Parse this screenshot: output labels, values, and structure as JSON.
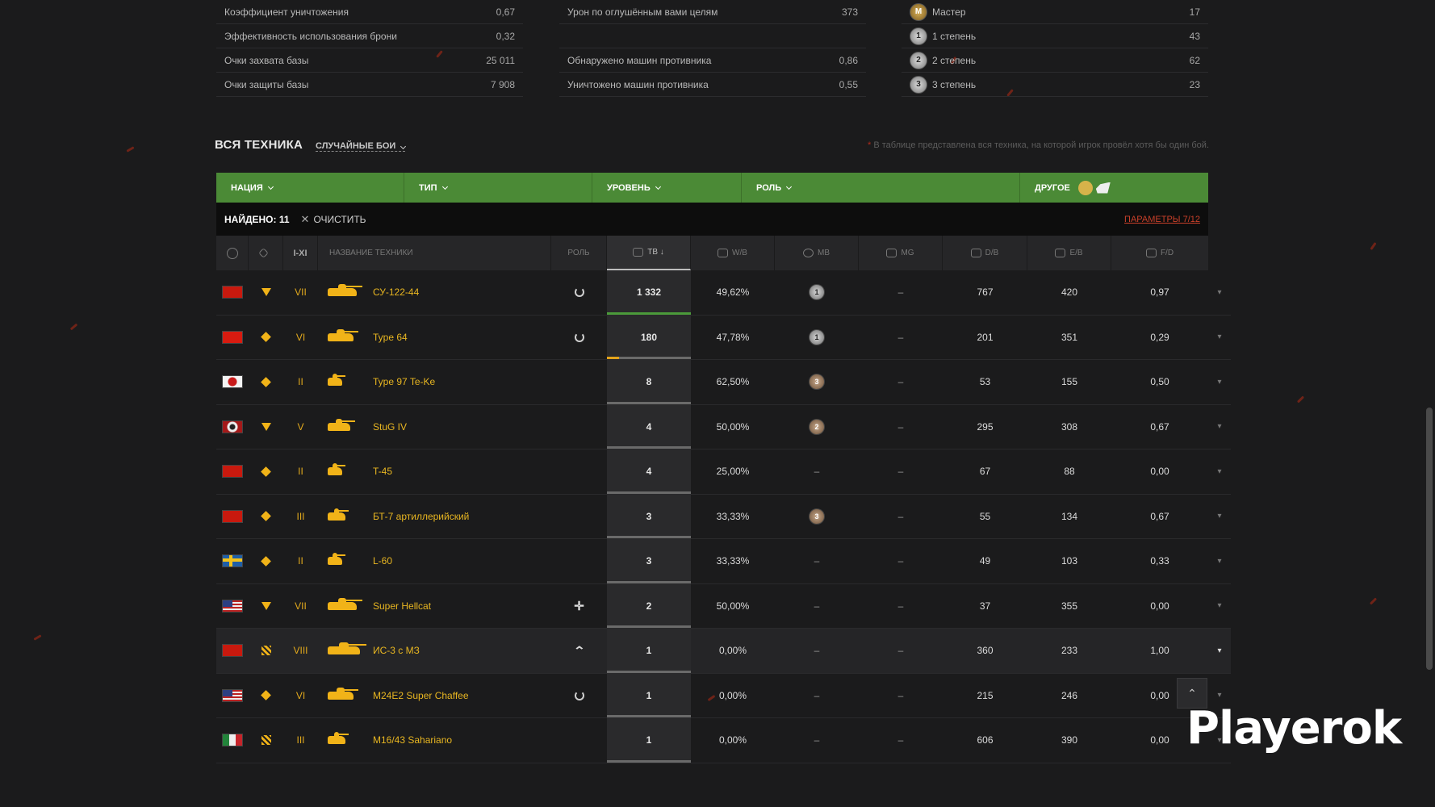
{
  "stats": {
    "col1": [
      {
        "label": "Коэффициент уничтожения",
        "value": "0,67"
      },
      {
        "label": "Эффективность использования брони",
        "value": "0,32"
      },
      {
        "label": "Очки захвата базы",
        "value": "25 011"
      },
      {
        "label": "Очки защиты базы",
        "value": "7 908"
      }
    ],
    "col2": [
      {
        "label": "Урон по оглушённым вами целям",
        "value": "373"
      },
      {
        "label": "",
        "value": ""
      },
      {
        "label": "Обнаружено машин противника",
        "value": "0,86"
      },
      {
        "label": "Уничтожено машин противника",
        "value": "0,55"
      }
    ],
    "col3": [
      {
        "badge": "M",
        "label": "Мастер",
        "value": "17"
      },
      {
        "badge": "1",
        "label": "1 степень",
        "value": "43"
      },
      {
        "badge": "2",
        "label": "2 степень",
        "value": "62"
      },
      {
        "badge": "3",
        "label": "3 степень",
        "value": "23"
      }
    ]
  },
  "section": {
    "title": "ВСЯ ТЕХНИКА",
    "battle_filter": "СЛУЧАЙНЫЕ БОИ",
    "note_star": "*",
    "note": "В таблице представлена вся техника, на которой игрок провёл хотя бы один бой."
  },
  "filters": {
    "nation": "НАЦИЯ",
    "type": "ТИП",
    "tier": "УРОВЕНЬ",
    "role": "РОЛЬ",
    "other": "ДРУГОЕ"
  },
  "found": {
    "label": "НАЙДЕНО: 11",
    "clear": "ОЧИСТИТЬ",
    "params": "ПАРАМЕТРЫ 7/12"
  },
  "columns": {
    "tier": "I-XI",
    "name": "НАЗВАНИЕ ТЕХНИКИ",
    "role": "РОЛЬ",
    "battles": "ТВ ↓",
    "wb": "W/B",
    "mb": "MB",
    "mg": "MG",
    "db": "D/B",
    "eb": "E/B",
    "fd": "F/D"
  },
  "rows": [
    {
      "flag": "ussr",
      "type": "tri",
      "tier": "VII",
      "name": "СУ-122-44",
      "role": "rot",
      "battles": "1 332",
      "bar_fraction": 1.0,
      "bar_color": "#4b9a3a",
      "wb": "49,62%",
      "mb": "1",
      "mg": "–",
      "db": "767",
      "eb": "420",
      "fd": "0,97"
    },
    {
      "flag": "china",
      "type": "dia",
      "tier": "VI",
      "name": "Type 64",
      "role": "rot",
      "battles": "180",
      "bar_fraction": 0.14,
      "bar_color": "#e3a31b",
      "wb": "47,78%",
      "mb": "1",
      "mg": "–",
      "db": "201",
      "eb": "351",
      "fd": "0,29"
    },
    {
      "flag": "japan",
      "type": "dia",
      "tier": "II",
      "name": "Type 97 Te-Ke",
      "role": "",
      "battles": "8",
      "bar_fraction": 0.0,
      "bar_color": "#6a6a6a",
      "wb": "62,50%",
      "mb": "3",
      "mg": "–",
      "db": "53",
      "eb": "155",
      "fd": "0,50"
    },
    {
      "flag": "germany",
      "type": "tri",
      "tier": "V",
      "name": "StuG IV",
      "role": "",
      "battles": "4",
      "bar_fraction": 0.0,
      "bar_color": "#6a6a6a",
      "wb": "50,00%",
      "mb": "2",
      "mg": "–",
      "db": "295",
      "eb": "308",
      "fd": "0,67"
    },
    {
      "flag": "ussr",
      "type": "dia",
      "tier": "II",
      "name": "T-45",
      "role": "",
      "battles": "4",
      "bar_fraction": 0.0,
      "bar_color": "#6a6a6a",
      "wb": "25,00%",
      "mb": "–",
      "mg": "–",
      "db": "67",
      "eb": "88",
      "fd": "0,00"
    },
    {
      "flag": "ussr",
      "type": "dia",
      "tier": "III",
      "name": "БТ-7 артиллерийский",
      "role": "",
      "battles": "3",
      "bar_fraction": 0.0,
      "bar_color": "#6a6a6a",
      "wb": "33,33%",
      "mb": "3",
      "mg": "–",
      "db": "55",
      "eb": "134",
      "fd": "0,67"
    },
    {
      "flag": "sweden",
      "type": "dia",
      "tier": "II",
      "name": "L-60",
      "role": "",
      "battles": "3",
      "bar_fraction": 0.0,
      "bar_color": "#6a6a6a",
      "wb": "33,33%",
      "mb": "–",
      "mg": "–",
      "db": "49",
      "eb": "103",
      "fd": "0,33"
    },
    {
      "flag": "usa",
      "type": "tri",
      "tier": "VII",
      "name": "Super Hellcat",
      "role": "cross",
      "battles": "2",
      "bar_fraction": 0.0,
      "bar_color": "#6a6a6a",
      "wb": "50,00%",
      "mb": "–",
      "mg": "–",
      "db": "37",
      "eb": "355",
      "fd": "0,00"
    },
    {
      "flag": "ussr",
      "type": "spg",
      "tier": "VIII",
      "name": "ИС-3 с МЗ",
      "role": "up",
      "battles": "1",
      "bar_fraction": 0.0,
      "bar_color": "#6a6a6a",
      "wb": "0,00%",
      "mb": "–",
      "mg": "–",
      "db": "360",
      "eb": "233",
      "fd": "1,00"
    },
    {
      "flag": "usa",
      "type": "dia",
      "tier": "VI",
      "name": "M24E2 Super Chaffee",
      "role": "rot",
      "battles": "1",
      "bar_fraction": 0.0,
      "bar_color": "#6a6a6a",
      "wb": "0,00%",
      "mb": "–",
      "mg": "–",
      "db": "215",
      "eb": "246",
      "fd": "0,00"
    },
    {
      "flag": "italy",
      "type": "spg",
      "tier": "III",
      "name": "M16/43 Sahariano",
      "role": "",
      "battles": "1",
      "bar_fraction": 0.0,
      "bar_color": "#6a6a6a",
      "wb": "0,00%",
      "mb": "–",
      "mg": "–",
      "db": "606",
      "eb": "390",
      "fd": "0,00"
    }
  ],
  "watermark": "Playerok",
  "to_top_icon": "double-chevron-up-icon"
}
